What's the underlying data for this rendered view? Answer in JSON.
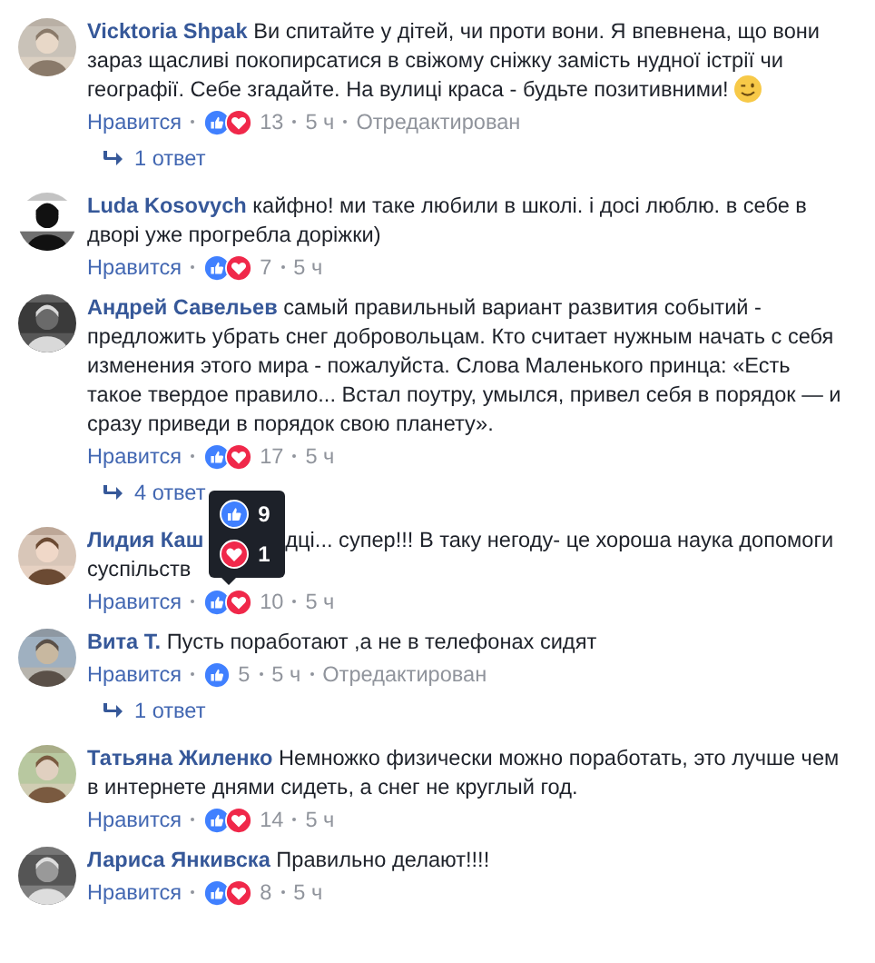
{
  "comments": [
    {
      "name": "Vicktoria Shpak",
      "text": "Ви спитайте у дітей, чи проти вони. Я впевнена, що вони зараз щасливі покопирсатися в свіжому сніжку замість нудної істрії чи географії. Себе згадайте. На вулиці краса - будьте позитивними!",
      "emoji": {
        "kind": "wink"
      },
      "like_label": "Нравится",
      "reactions": [
        {
          "kind": "like"
        },
        {
          "kind": "love"
        }
      ],
      "count": "13",
      "time": "5 ч",
      "edited_label": "Отредактирован",
      "replies": "1 ответ"
    },
    {
      "name": "Luda Kosovych",
      "text": "кайфно! ми таке любили в школі. і досі люблю. в себе в дворі уже прогребла доріжки)",
      "like_label": "Нравится",
      "reactions": [
        {
          "kind": "like"
        },
        {
          "kind": "love"
        }
      ],
      "count": "7",
      "time": "5 ч"
    },
    {
      "name": "Андрей Савельев",
      "text": "самый правильный вариант развития событий - предложить убрать снег добровольцам. Кто считает нужным начать с себя изменения этого мира - пожалуйста. Слова Маленького принца: «Есть такое твердое правило... Встал поутру, умылся, привел себя в порядок — и сразу приведи в порядок свою планету».",
      "like_label": "Нравится",
      "reactions": [
        {
          "kind": "like"
        },
        {
          "kind": "love"
        }
      ],
      "count": "17",
      "time": "5 ч",
      "replies": "4 ответ"
    },
    {
      "name": "Лидия Каш",
      "text": "дці... супер!!! В таку негоду- це хороша наука допомоги",
      "text_continued": "суспільств",
      "like_label": "Нравится",
      "reactions": [
        {
          "kind": "like"
        },
        {
          "kind": "love"
        }
      ],
      "count": "10",
      "time": "5 ч",
      "tooltip": [
        {
          "kind": "like",
          "count": "9"
        },
        {
          "kind": "love",
          "count": "1"
        }
      ]
    },
    {
      "name": "Вита Т.",
      "text": "Пусть поработают ,а не в телефонах сидят",
      "like_label": "Нравится",
      "reactions": [
        {
          "kind": "like"
        }
      ],
      "count": "5",
      "time": "5 ч",
      "edited_label": "Отредактирован",
      "replies": "1 ответ"
    },
    {
      "name": "Татьяна Жиленко",
      "text": "Немножко физически можно поработать, это лучше чем в интернете днями сидеть, а снег не круглый год.",
      "like_label": "Нравится",
      "reactions": [
        {
          "kind": "like"
        },
        {
          "kind": "love"
        }
      ],
      "count": "14",
      "time": "5 ч"
    },
    {
      "name": "Лариса Янкивска",
      "text": "Правильно делают!!!!",
      "like_label": "Нравится",
      "reactions": [
        {
          "kind": "like"
        },
        {
          "kind": "love"
        }
      ],
      "count": "8",
      "time": "5 ч"
    }
  ]
}
